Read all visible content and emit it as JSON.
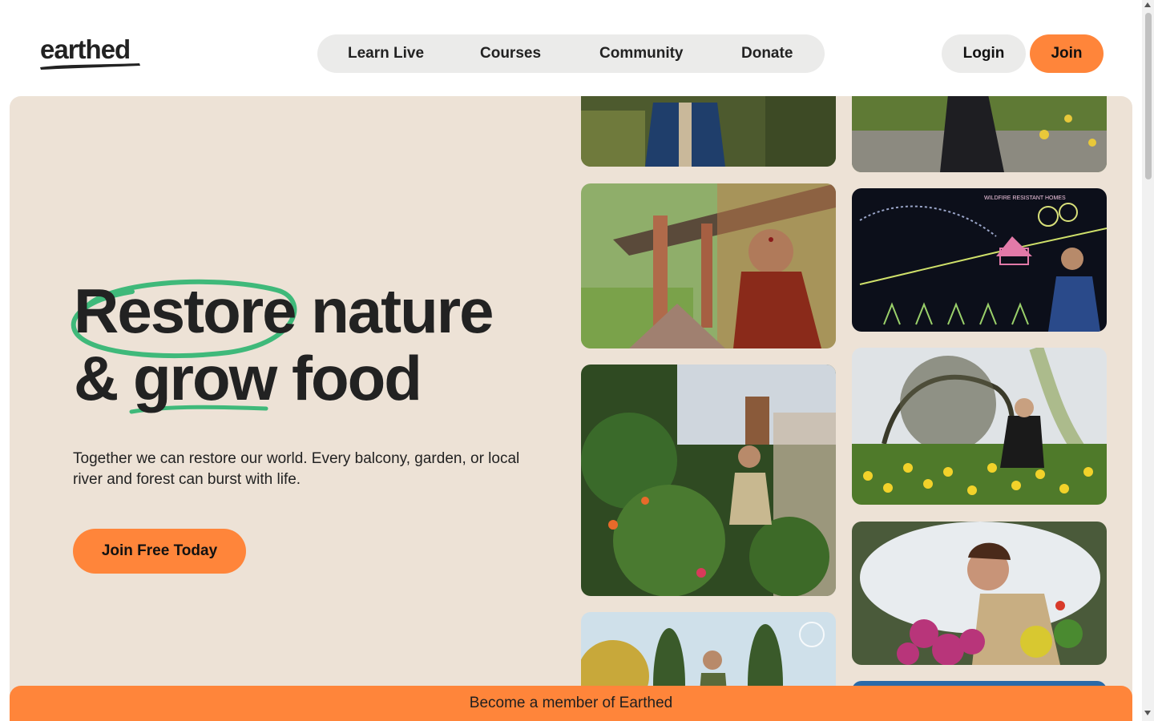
{
  "brand": {
    "logo_text": "earthed"
  },
  "nav": {
    "items": [
      {
        "label": "Learn Live"
      },
      {
        "label": "Courses"
      },
      {
        "label": "Community"
      },
      {
        "label": "Donate"
      }
    ]
  },
  "auth": {
    "login_label": "Login",
    "join_label": "Join"
  },
  "hero": {
    "headline_line1_word1": "Restore",
    "headline_line1_word2": "nature",
    "headline_line2_word1": "&",
    "headline_line2_word2": "grow",
    "headline_line2_word3": "food",
    "subtitle": "Together we can restore our world. Every balcony, garden, or local river and forest can burst with life.",
    "cta_label": "Join Free Today"
  },
  "photos": [
    {
      "name": "person-blue-jacket-photo"
    },
    {
      "name": "person-in-garden-photo"
    },
    {
      "name": "woman-red-shawl-photo"
    },
    {
      "name": "chalkboard-lecture-photo"
    },
    {
      "name": "greenhouse-gardener-photo"
    },
    {
      "name": "daffodils-gardening-photo"
    },
    {
      "name": "man-with-flowers-photo"
    },
    {
      "name": "garden-man-photo"
    },
    {
      "name": "river-photo"
    }
  ],
  "chalkboard_text": "WILDFIRE RESISTANT HOMES",
  "banner": {
    "label": "Become a member of Earthed"
  },
  "colors": {
    "accent": "#ff853a",
    "hero_bg": "#ede2d6",
    "pill_bg": "#ebebea",
    "highlight_green": "#3fb97a",
    "text": "#222222"
  }
}
